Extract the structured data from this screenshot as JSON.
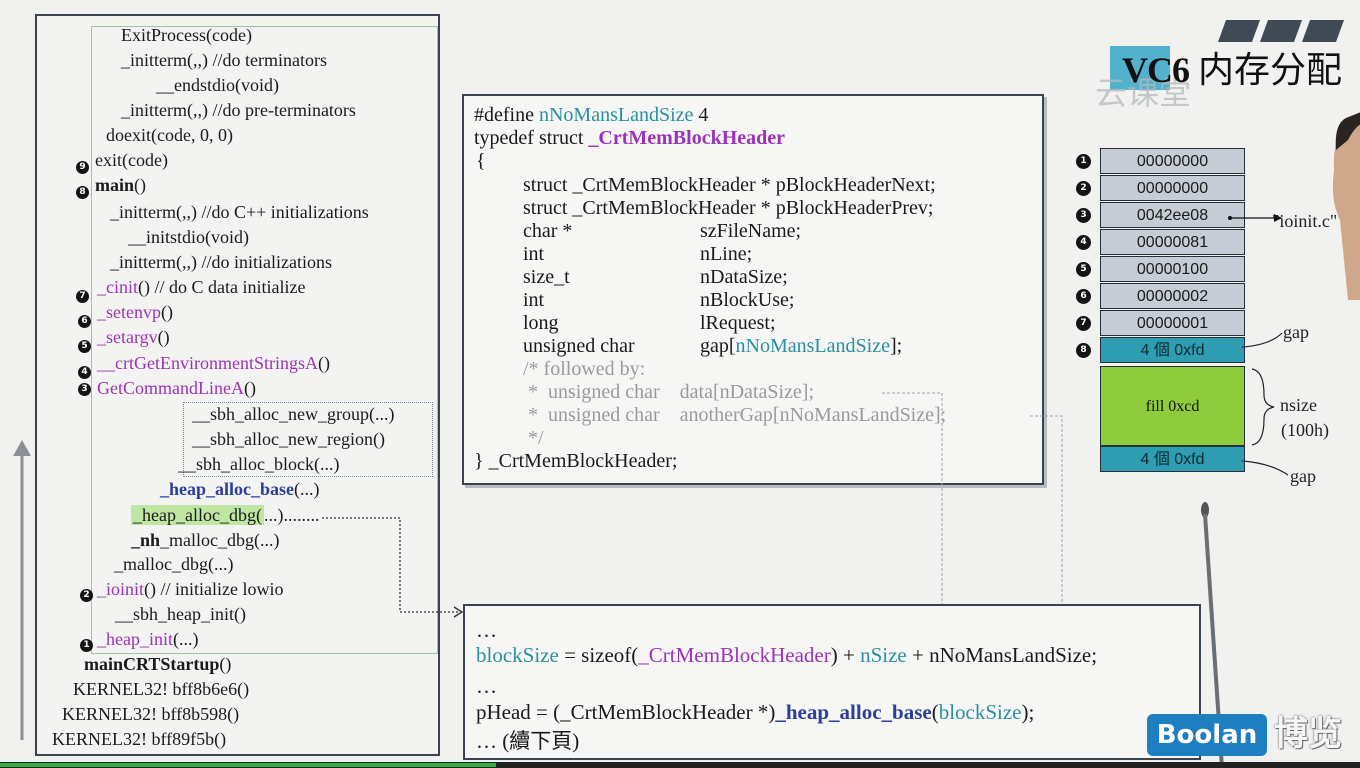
{
  "slide": {
    "title_prefix": "VC6",
    "title_suffix": "内存分配",
    "watermark": "云课堂"
  },
  "call_stack": {
    "lines": [
      {
        "text": "ExitProcess(code)"
      },
      {
        "text": "_initterm(,,)    //do terminators"
      },
      {
        "text": "__endstdio(void)"
      },
      {
        "text": "_initterm(,,)    //do pre-terminators"
      },
      {
        "text": "doexit(code, 0, 0)"
      },
      {
        "text": "exit(code)",
        "num": "9"
      },
      {
        "pre": "",
        "bold": "main",
        "post": "()",
        "num": "8"
      },
      {
        "text": "_initterm(,,)   //do C++ initializations"
      },
      {
        "text": "__initstdio(void)"
      },
      {
        "text": "_initterm(,,)   //do initializations"
      },
      {
        "purple": "_cinit",
        "post": "()   // do C data initialize",
        "num": "7"
      },
      {
        "purple": "_setenvp",
        "post": "()",
        "num": "6"
      },
      {
        "purple": "_setargv",
        "post": "()",
        "num": "5"
      },
      {
        "purple": "__crtGetEnvironmentStringsA",
        "post": "()",
        "num": "4"
      },
      {
        "purple": "GetCommandLineA",
        "post": "()",
        "num": "3"
      },
      {
        "text": "__sbh_alloc_new_group(...)"
      },
      {
        "text": "__sbh_alloc_new_region()"
      },
      {
        "text": "__sbh_alloc_block(...)"
      },
      {
        "bold": "_heap_alloc_base",
        "post": "(...)"
      },
      {
        "hl": "_heap_alloc_dbg(",
        "post": "...)........"
      },
      {
        "boldpre": "_nh",
        "post": "_malloc_dbg(...)"
      },
      {
        "text": "_malloc_dbg(...)"
      },
      {
        "purple": "_ioinit",
        "post": "()  // initialize lowio",
        "num": "2"
      },
      {
        "text": "__sbh_heap_init()"
      },
      {
        "purple": "_heap_init",
        "post": "(...)",
        "num": "1"
      },
      {
        "bold": "mainCRTStartup",
        "post": "()"
      },
      {
        "text": "KERNEL32! bff8b6e6()"
      },
      {
        "text": "KERNEL32! bff8b598()"
      },
      {
        "text": "KERNEL32! bff89f5b()"
      }
    ]
  },
  "struct_code": {
    "l1_pre": "#define ",
    "l1_macro": "nNoMansLandSize",
    "l1_post": " 4",
    "l2_pre": "typedef struct ",
    "l2_name": "_CrtMemBlockHeader",
    "l3": "{",
    "members": [
      {
        "type": "struct _CrtMemBlockHeader * pBlockHeaderNext;",
        "name": ""
      },
      {
        "type": "struct _CrtMemBlockHeader * pBlockHeaderPrev;",
        "name": ""
      },
      {
        "type": "char *",
        "name": "szFileName;"
      },
      {
        "type": "int",
        "name": "nLine;"
      },
      {
        "type": "size_t",
        "name": "nDataSize;"
      },
      {
        "type": "int",
        "name": "nBlockUse;"
      },
      {
        "type": "long",
        "name": "lRequest;"
      },
      {
        "type": "unsigned char",
        "name": "gap[",
        "macro": "nNoMansLandSize",
        "tail": "];"
      }
    ],
    "comment": [
      "/* followed by:",
      " *  unsigned char    data[nDataSize];",
      " *  unsigned char    anotherGap[nNoMansLandSize];",
      " */"
    ],
    "close": "} _CrtMemBlockHeader;"
  },
  "alloc_code": {
    "l1": "…",
    "l2_a": "blockSize",
    "l2_b": " = sizeof(",
    "l2_c": "_CrtMemBlockHeader",
    "l2_d": ") + ",
    "l2_e": "nSize",
    "l2_f": " + nNoMansLandSize;",
    "l3": "…",
    "l4_a": "pHead = (_CrtMemBlockHeader *)",
    "l4_b": "_heap_alloc_base",
    "l4_c": "(",
    "l4_d": "blockSize",
    "l4_e": ");",
    "l5": "… (續下頁)"
  },
  "memory_block": {
    "cells": [
      {
        "num": "1",
        "value": "00000000"
      },
      {
        "num": "2",
        "value": "00000000"
      },
      {
        "num": "3",
        "value": "0042ee08"
      },
      {
        "num": "4",
        "value": "00000081"
      },
      {
        "num": "5",
        "value": "00000100"
      },
      {
        "num": "6",
        "value": "00000002"
      },
      {
        "num": "7",
        "value": "00000001"
      },
      {
        "num": "8",
        "value": "4 個 0xfd"
      }
    ],
    "fill_label": "fill 0xcd",
    "gap2_label": "4 個 0xfd",
    "pointer_label": "\"ioinit.c\"",
    "gap_label_top": "gap",
    "gap_label_bottom": "gap",
    "nsize_label": "nsize",
    "nsize_value": "(100h)"
  },
  "brand": {
    "logo": "Boolan",
    "logo_cn": "博览"
  },
  "colors": {
    "purple": "#9b33b9",
    "teal": "#2a8fa3",
    "gap_cell": "#2e9cb1",
    "fill_cell": "#8fcc3b",
    "cell": "#c5ccd5",
    "logo": "#1e7fc0"
  },
  "video": {
    "progress": 0.365
  }
}
